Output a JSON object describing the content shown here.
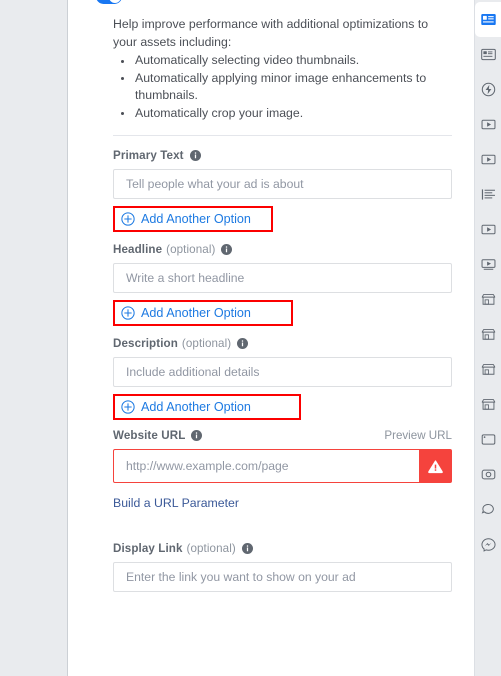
{
  "colors": {
    "accent_blue": "#1877f2",
    "link_blue": "#1d7ae2",
    "link_navy": "#3b5998",
    "annotation_red": "#fc0000",
    "error_red": "#f5433d",
    "panel_gray": "#e9ebee",
    "label_gray": "#606770"
  },
  "toggle": {
    "name": "advantage-plus-creative-toggle",
    "state": "on"
  },
  "intro": {
    "paragraph": "Help improve performance with additional optimizations to your assets including:",
    "bullets": [
      "Automatically selecting video thumbnails.",
      "Automatically applying minor image enhancements to thumbnails.",
      "Automatically crop your image."
    ]
  },
  "fields": [
    {
      "id": "primary-text",
      "label": "Primary Text",
      "optional": "",
      "info_icon": "info-icon",
      "placeholder": "Tell people what your ad is about",
      "value": "",
      "add_option_label": "Add Another Option",
      "add_option_icon": "plus-circle-icon",
      "highlighted": true
    },
    {
      "id": "headline",
      "label": "Headline",
      "optional": "(optional)",
      "info_icon": "info-icon",
      "placeholder": "Write a short headline",
      "value": "",
      "add_option_label": "Add Another Option",
      "add_option_icon": "plus-circle-icon",
      "highlighted": true
    },
    {
      "id": "description",
      "label": "Description",
      "optional": "(optional)",
      "info_icon": "info-icon",
      "placeholder": "Include additional details",
      "value": "",
      "add_option_label": "Add Another Option",
      "add_option_icon": "plus-circle-icon",
      "highlighted": true
    }
  ],
  "website_url": {
    "label": "Website URL",
    "info_icon": "info-icon",
    "preview_link_label": "Preview URL",
    "placeholder": "http://www.example.com/page",
    "value": "",
    "has_error": true,
    "error_icon": "warning-triangle-icon",
    "build_param_label": "Build a URL Parameter"
  },
  "display_link": {
    "label": "Display Link",
    "optional": "(optional)",
    "info_icon": "info-icon",
    "placeholder": "Enter the link you want to show on your ad",
    "value": ""
  },
  "rail": {
    "items": [
      {
        "name": "desktop-feed-icon",
        "selected": true
      },
      {
        "name": "feed-card-icon",
        "selected": false
      },
      {
        "name": "instant-article-icon",
        "selected": false
      },
      {
        "name": "in-stream-video-icon",
        "selected": false
      },
      {
        "name": "video-feeds-icon",
        "selected": false
      },
      {
        "name": "right-column-icon",
        "selected": false
      },
      {
        "name": "video-player-icon",
        "selected": false
      },
      {
        "name": "video-player-alt-icon",
        "selected": false
      },
      {
        "name": "marketplace-icon",
        "selected": false
      },
      {
        "name": "marketplace-alt-icon",
        "selected": false
      },
      {
        "name": "shops-icon",
        "selected": false
      },
      {
        "name": "shops-alt-icon",
        "selected": false
      },
      {
        "name": "mobile-device-icon",
        "selected": false
      },
      {
        "name": "instagram-icon",
        "selected": false
      },
      {
        "name": "messages-bubble-icon",
        "selected": false
      },
      {
        "name": "messenger-icon",
        "selected": false
      }
    ]
  }
}
